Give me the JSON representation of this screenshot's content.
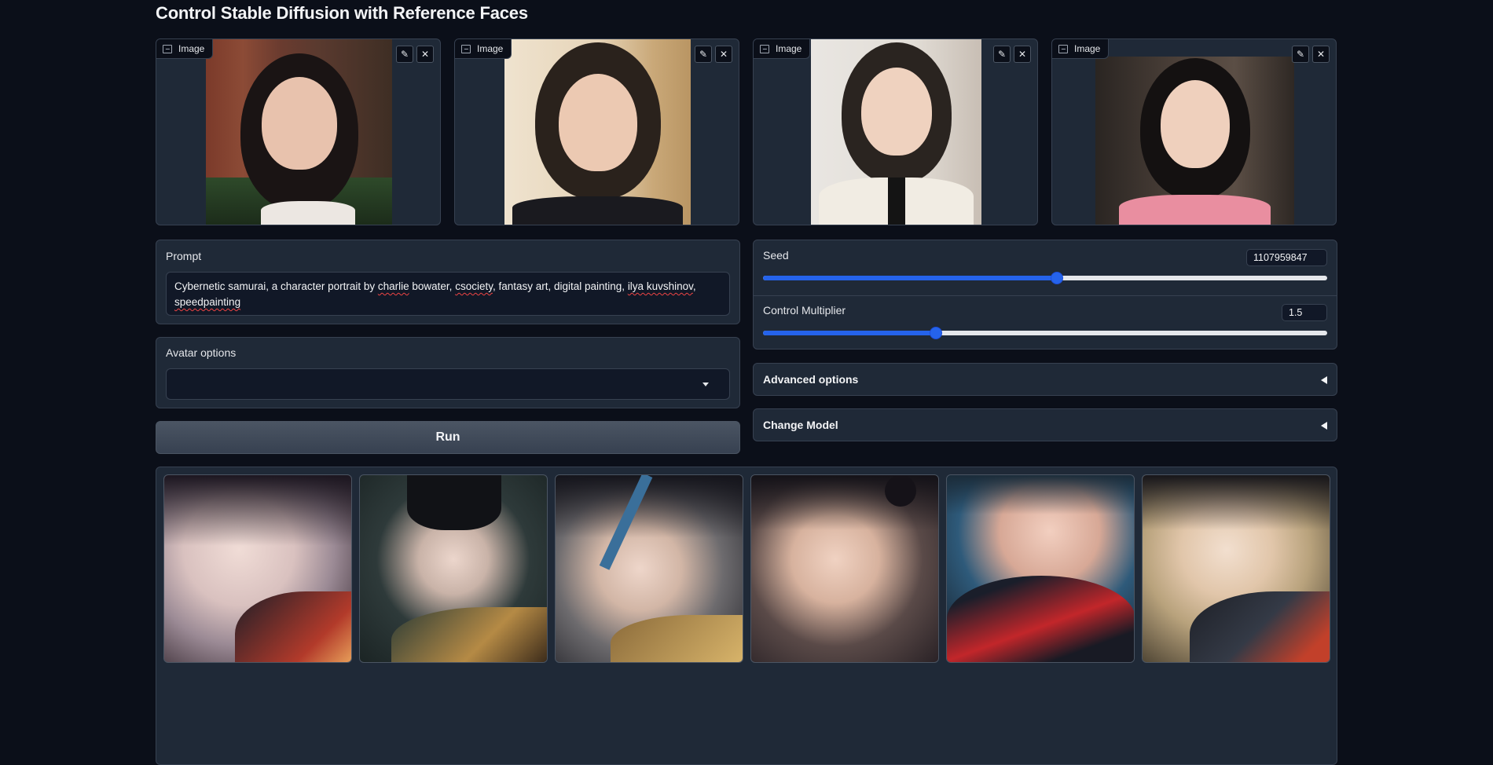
{
  "page": {
    "title": "Control Stable Diffusion with Reference Faces"
  },
  "reference_images": [
    {
      "label": "Image",
      "edit_icon": "pencil-icon",
      "clear_icon": "close-icon"
    },
    {
      "label": "Image",
      "edit_icon": "pencil-icon",
      "clear_icon": "close-icon"
    },
    {
      "label": "Image",
      "edit_icon": "pencil-icon",
      "clear_icon": "close-icon"
    },
    {
      "label": "Image",
      "edit_icon": "pencil-icon",
      "clear_icon": "close-icon"
    }
  ],
  "prompt": {
    "label": "Prompt",
    "value_parts": [
      "Cybernetic samurai, a character portrait by ",
      "charlie",
      " bowater, ",
      "csociety",
      ", fantasy art, digital painting, ",
      "ilya kuvshinov",
      ",",
      "speedpainting"
    ]
  },
  "avatar_options": {
    "label": "Avatar options",
    "selected": ""
  },
  "run_button": {
    "label": "Run"
  },
  "seed": {
    "label": "Seed",
    "value": "1107959847",
    "fraction": 0.52
  },
  "control_multiplier": {
    "label": "Control Multiplier",
    "value": "1.5",
    "fraction": 0.305
  },
  "advanced_options": {
    "label": "Advanced options",
    "icon": "collapse-triangle-icon"
  },
  "change_model": {
    "label": "Change Model",
    "icon": "collapse-triangle-icon"
  },
  "gallery": {
    "count": 6
  },
  "colors": {
    "background": "#0b0f19",
    "panel": "#1f2937",
    "accent": "#2563eb"
  }
}
